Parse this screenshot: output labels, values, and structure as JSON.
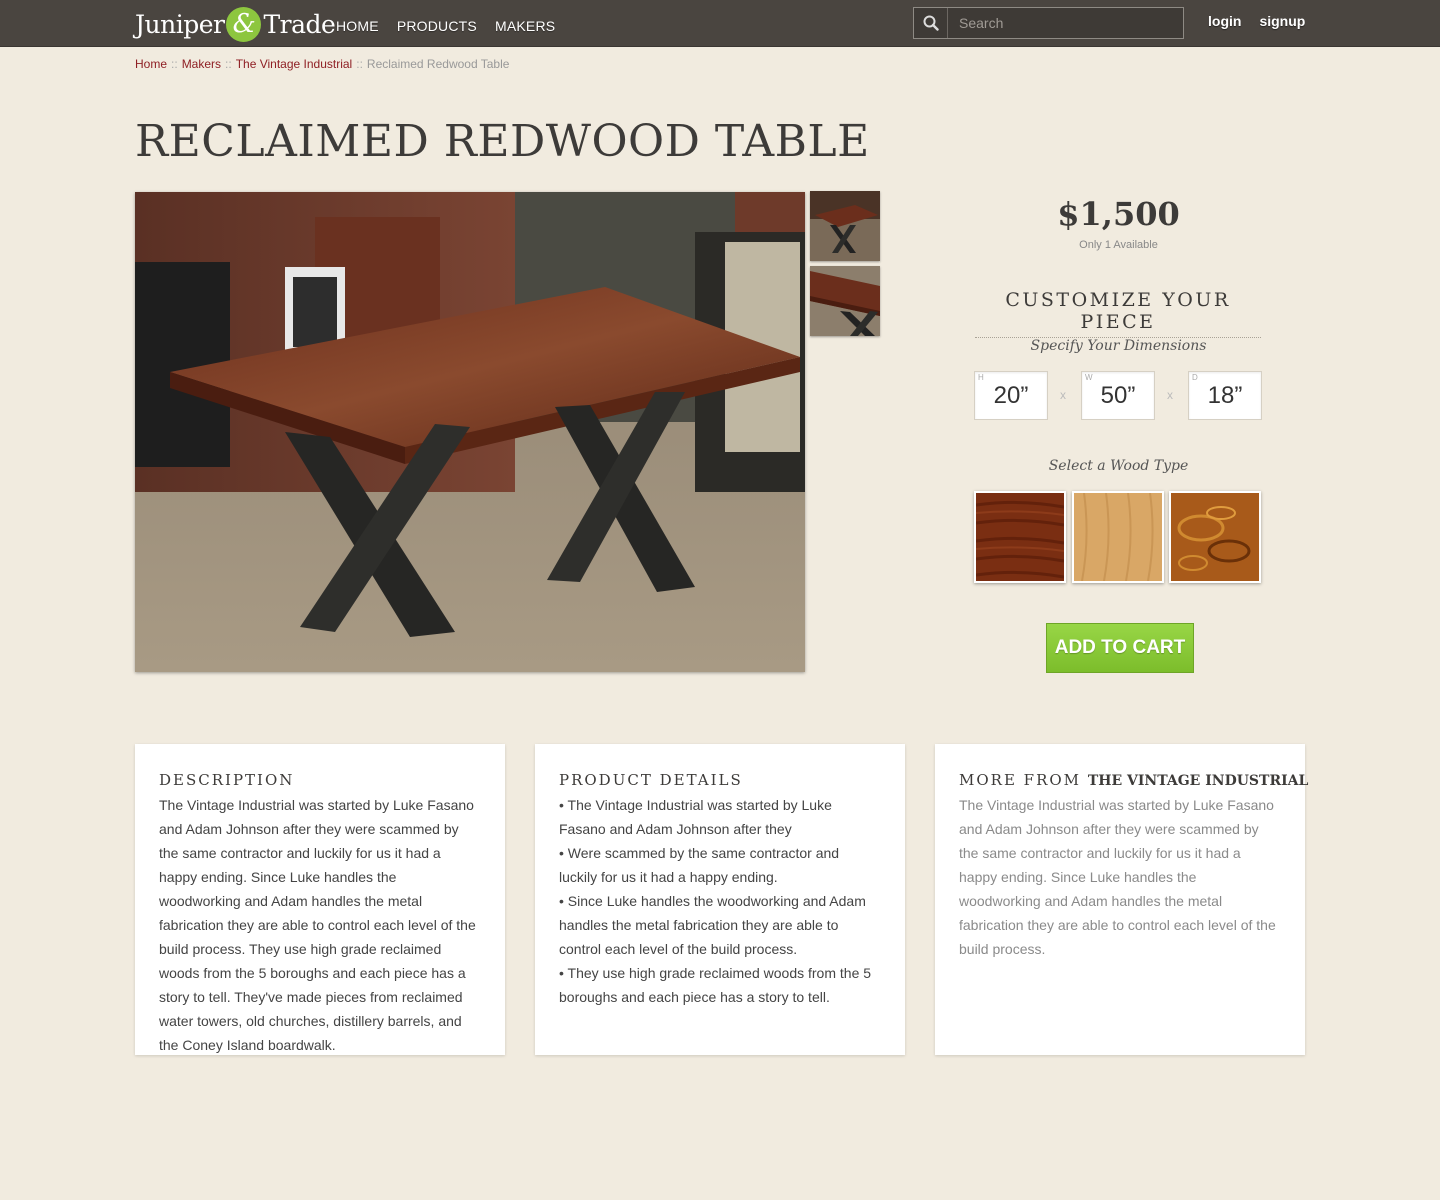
{
  "header": {
    "logo": {
      "left": "Juniper",
      "amp": "&",
      "right": "Trade"
    },
    "nav": [
      "HOME",
      "PRODUCTS",
      "MAKERS"
    ],
    "search_placeholder": "Search",
    "login": "login",
    "signup": "signup"
  },
  "breadcrumb": {
    "items": [
      "Home",
      "Makers",
      "The Vintage Industrial"
    ],
    "separator": "::",
    "current": "Reclaimed Redwood Table"
  },
  "product": {
    "title": "RECLAIMED REDWOOD TABLE",
    "price": "$1,500",
    "availability": "Only 1 Available"
  },
  "customize": {
    "heading": "CUSTOMIZE YOUR PIECE",
    "dimensions_label": "Specify Your Dimensions",
    "dimensions": [
      {
        "label": "H",
        "value": "20”"
      },
      {
        "label": "W",
        "value": "50”"
      },
      {
        "label": "D",
        "value": "18”"
      }
    ],
    "dimension_separator": "x",
    "wood_label": "Select a Wood Type",
    "wood_colors": [
      "#7a2e12",
      "#d9a766",
      "#a85a1a"
    ]
  },
  "cart_button": "ADD TO CART",
  "description": {
    "heading": "DESCRIPTION",
    "text": "The Vintage Industrial was started by Luke Fasano and Adam Johnson after they were scammed by the same contractor and luckily for us it had a happy ending. Since Luke handles the woodworking and Adam handles the metal fabrication they are able to control each level of the build process. They use high grade reclaimed woods from the 5 boroughs and each piece has a story to tell. They've made pieces from reclaimed water towers, old churches, distillery barrels, and the Coney Island boardwalk."
  },
  "product_details": {
    "heading": "PRODUCT DETAILS",
    "bullets": [
      "• The Vintage Industrial was started by Luke Fasano and Adam Johnson after they",
      "• Were scammed by the same contractor and luckily for us it had a happy ending.",
      "• Since Luke handles the woodworking and Adam handles the metal fabrication they are able to control each level of the build process.",
      "• They use high grade reclaimed woods from the 5 boroughs and each piece has a story to tell."
    ]
  },
  "more_from": {
    "heading_prefix": "MORE FROM",
    "maker": "THE VINTAGE INDUSTRIAL",
    "text": "The Vintage Industrial was started by Luke Fasano and Adam Johnson after they were scammed by the same contractor and luckily for us it had a happy ending. Since Luke handles the woodworking and Adam handles the metal fabrication they are able to control each level of the build process."
  },
  "colors": {
    "topbar": "#4a4540",
    "background": "#f1ebdf",
    "accent_green": "#8dc63f",
    "link": "#8f1f24"
  }
}
